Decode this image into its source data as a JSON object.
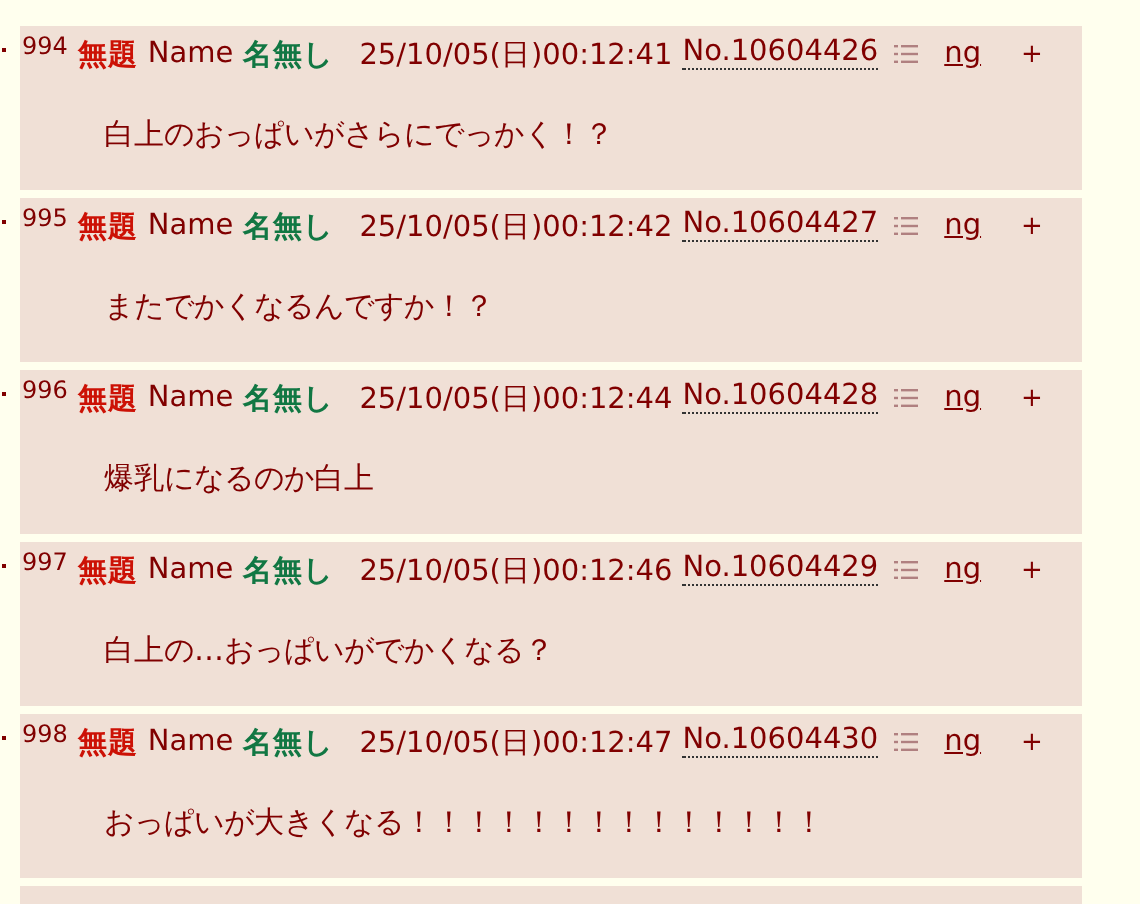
{
  "posts": [
    {
      "number": "994",
      "title": "無題",
      "name_label": "Name",
      "name": "名無し",
      "datetime": "25/10/05(日)00:12:41",
      "post_no": "No.10604426",
      "ng": "ng",
      "plus": "+",
      "body": "白上のおっぱいがさらにでっかく！？"
    },
    {
      "number": "995",
      "title": "無題",
      "name_label": "Name",
      "name": "名無し",
      "datetime": "25/10/05(日)00:12:42",
      "post_no": "No.10604427",
      "ng": "ng",
      "plus": "+",
      "body": "またでかくなるんですか！？"
    },
    {
      "number": "996",
      "title": "無題",
      "name_label": "Name",
      "name": "名無し",
      "datetime": "25/10/05(日)00:12:44",
      "post_no": "No.10604428",
      "ng": "ng",
      "plus": "+",
      "body": "爆乳になるのか白上"
    },
    {
      "number": "997",
      "title": "無題",
      "name_label": "Name",
      "name": "名無し",
      "datetime": "25/10/05(日)00:12:46",
      "post_no": "No.10604429",
      "ng": "ng",
      "plus": "+",
      "body": "白上の…おっぱいがでかくなる？"
    },
    {
      "number": "998",
      "title": "無題",
      "name_label": "Name",
      "name": "名無し",
      "datetime": "25/10/05(日)00:12:47",
      "post_no": "No.10604430",
      "ng": "ng",
      "plus": "+",
      "body": "おっぱいが大きくなる！！！！！！！！！！！！！！"
    }
  ]
}
